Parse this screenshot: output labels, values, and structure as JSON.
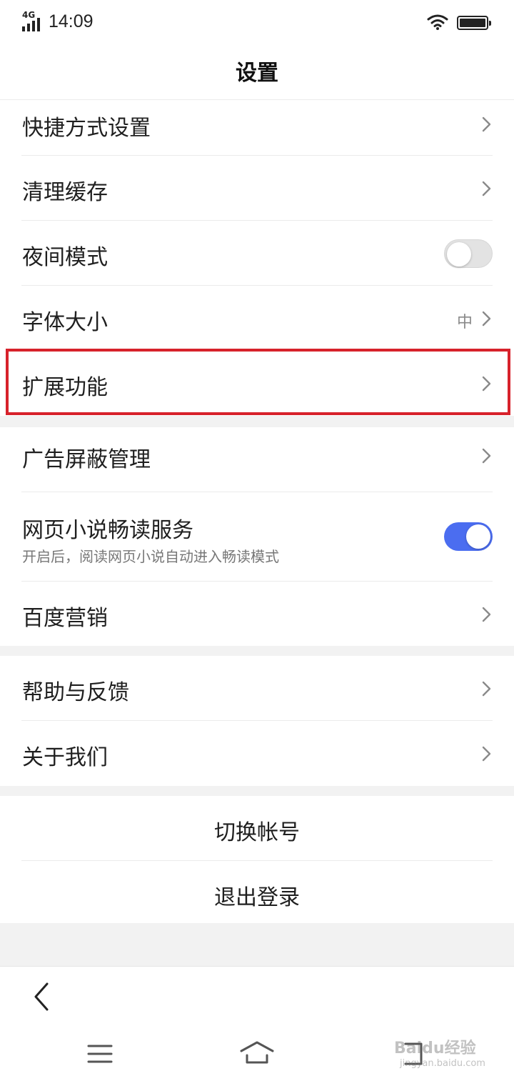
{
  "status_bar": {
    "network": "4G",
    "time": "14:09"
  },
  "header": {
    "title": "设置"
  },
  "section1": [
    {
      "label": "快捷方式设置",
      "type": "link"
    },
    {
      "label": "清理缓存",
      "type": "link"
    },
    {
      "label": "夜间模式",
      "type": "toggle",
      "on": false
    },
    {
      "label": "字体大小",
      "type": "link",
      "value": "中"
    },
    {
      "label": "扩展功能",
      "type": "link"
    }
  ],
  "section2": [
    {
      "label": "广告屏蔽管理",
      "type": "link"
    },
    {
      "label": "网页小说畅读服务",
      "subtitle": "开启后，阅读网页小说自动进入畅读模式",
      "type": "toggle",
      "on": true
    },
    {
      "label": "百度营销",
      "type": "link"
    }
  ],
  "section3": [
    {
      "label": "帮助与反馈",
      "type": "link"
    },
    {
      "label": "关于我们",
      "type": "link"
    }
  ],
  "section4": [
    {
      "label": "切换帐号"
    },
    {
      "label": "退出登录"
    }
  ],
  "watermark": {
    "brand": "Baidu经验",
    "url": "jingyan.baidu.com"
  },
  "colors": {
    "accent": "#4b6df0",
    "highlight": "#d7222b",
    "divider": "#ebebeb",
    "section_gap": "#f2f2f2"
  },
  "icons": [
    "chevron-right-icon",
    "back-arrow-icon",
    "menu-icon",
    "home-icon",
    "recent-apps-icon",
    "wifi-icon",
    "battery-icon",
    "signal-icon"
  ]
}
